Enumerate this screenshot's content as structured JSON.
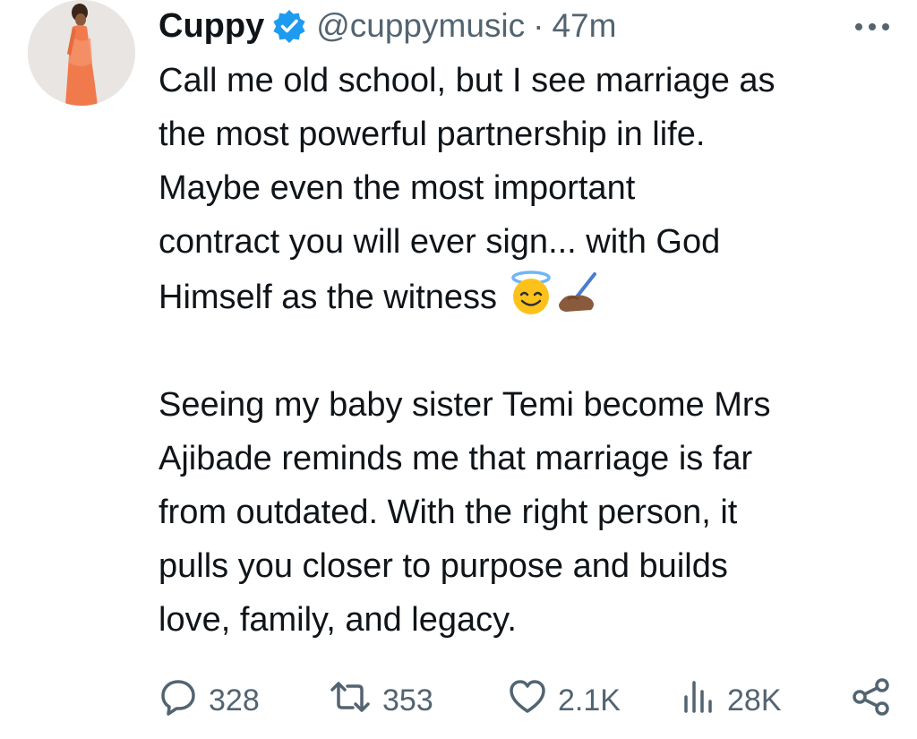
{
  "tweet": {
    "author_name": "Cuppy",
    "handle": "@cuppymusic",
    "separator": "·",
    "time": "47m",
    "text_lines": [
      "Call me old school, but I see marriage as",
      "the most powerful partnership in life.",
      "Maybe even the most important",
      "contract you will ever sign... with God",
      "Himself as the witness"
    ],
    "text_lines_2": [
      "Seeing my baby sister Temi become Mrs",
      "Ajibade reminds me that marriage is far",
      "from outdated. With the right person, it",
      "pulls you closer to purpose and builds",
      "love, family, and legacy."
    ],
    "emojis": [
      "smiling-face-with-halo-icon",
      "writing-hand-icon"
    ]
  },
  "actions": {
    "replies": "328",
    "retweets": "353",
    "likes": "2.1K",
    "views": "28K"
  },
  "icons": {
    "verified": "verified-badge-icon",
    "more": "more-options-icon",
    "reply": "reply-icon",
    "retweet": "retweet-icon",
    "like": "heart-icon",
    "views": "views-icon",
    "share": "share-icon"
  },
  "colors": {
    "verified_badge": "#1d9bf0",
    "text_primary": "#0f1419",
    "text_secondary": "#536471",
    "background": "#ffffff"
  }
}
